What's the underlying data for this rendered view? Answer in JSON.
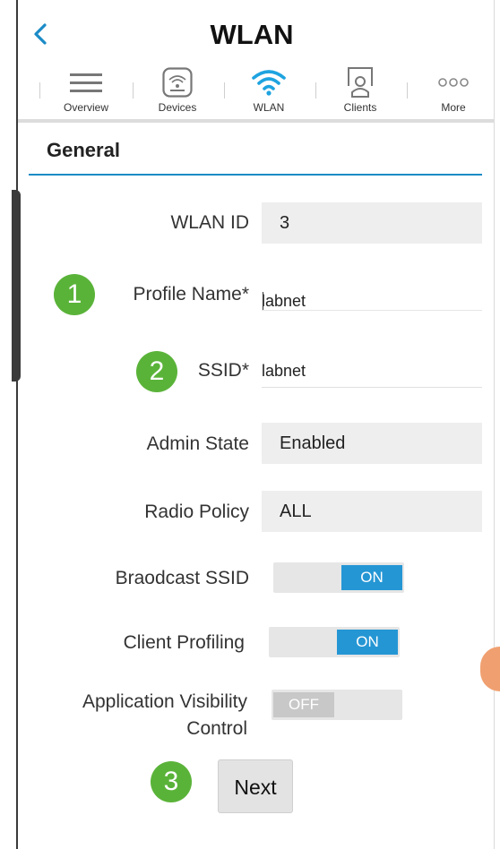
{
  "header": {
    "title": "WLAN"
  },
  "nav": {
    "items": [
      {
        "label": "Overview",
        "icon": "menu-icon"
      },
      {
        "label": "Devices",
        "icon": "device-icon"
      },
      {
        "label": "WLAN",
        "icon": "wifi-icon",
        "active": true
      },
      {
        "label": "Clients",
        "icon": "client-icon"
      },
      {
        "label": "More",
        "icon": "more-icon"
      }
    ]
  },
  "section": {
    "title": "General"
  },
  "form": {
    "wlan_id": {
      "label": "WLAN ID",
      "value": "3"
    },
    "profile_name": {
      "label": "Profile Name*",
      "value": "labnet",
      "badge": "1"
    },
    "ssid": {
      "label": "SSID*",
      "value": "labnet",
      "badge": "2"
    },
    "admin_state": {
      "label": "Admin State",
      "value": "Enabled"
    },
    "radio_policy": {
      "label": "Radio Policy",
      "value": "ALL"
    },
    "broadcast_ssid": {
      "label": "Braodcast SSID",
      "state": "ON"
    },
    "client_profiling": {
      "label": "Client Profiling",
      "state": "ON"
    },
    "app_visibility": {
      "label_line1": "Application Visibility",
      "label_line2": "Control",
      "state": "OFF"
    }
  },
  "actions": {
    "next_label": "Next",
    "next_badge": "3"
  },
  "colors": {
    "accent": "#1b8bc7",
    "toggle_on": "#2596d4",
    "badge": "#5ab339",
    "wifi": "#1ea3e0"
  }
}
